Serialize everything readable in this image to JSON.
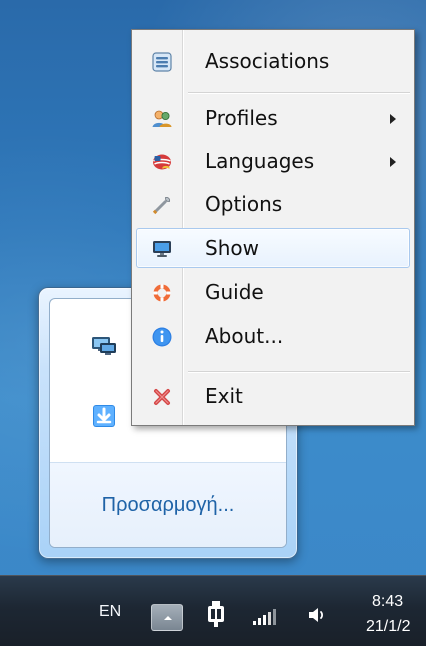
{
  "desktop": {
    "background_color": "#2f79bb"
  },
  "overflow_panel": {
    "customize_link": "Προσαρμογή...",
    "icons": [
      "monitor-network-icon",
      "download-arrow-icon"
    ]
  },
  "context_menu": {
    "items": [
      {
        "label": "Associations",
        "icon": "associations-icon",
        "submenu": false
      },
      {
        "label": "Profiles",
        "icon": "profiles-icon",
        "submenu": true
      },
      {
        "label": "Languages",
        "icon": "languages-icon",
        "submenu": true
      },
      {
        "label": "Options",
        "icon": "wrench-icon",
        "submenu": false
      },
      {
        "label": "Show",
        "icon": "monitor-icon",
        "submenu": false,
        "hovered": true
      },
      {
        "label": "Guide",
        "icon": "lifebuoy-icon",
        "submenu": false
      },
      {
        "label": "About...",
        "icon": "info-icon",
        "submenu": false
      },
      {
        "label": "Exit",
        "icon": "exit-icon",
        "submenu": false
      }
    ]
  },
  "taskbar": {
    "language": "EN",
    "clock": {
      "time": "8:43 ",
      "date": "21/1/2"
    },
    "icons": [
      "show-hidden-icons-icon",
      "power-icon",
      "signal-icon",
      "volume-icon"
    ],
    "colors": {
      "taskbar": "#1d2733",
      "text": "#ffffff"
    }
  }
}
